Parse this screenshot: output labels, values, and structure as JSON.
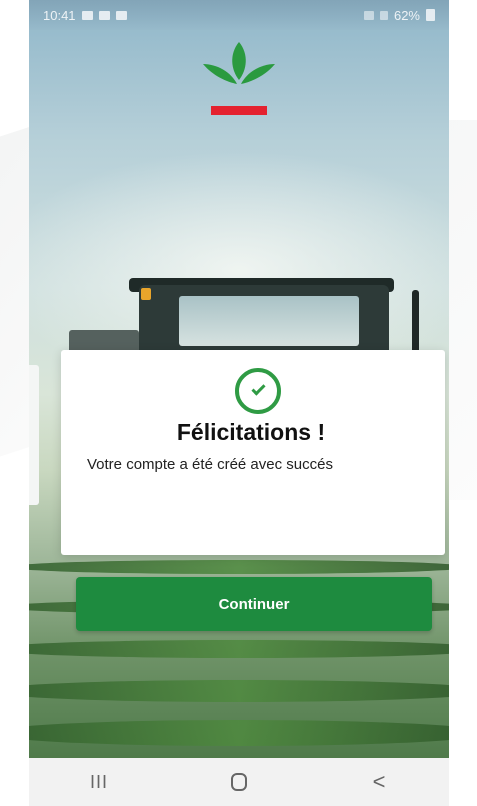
{
  "status_bar": {
    "time": "10:41",
    "battery": "62%"
  },
  "dialog": {
    "icon": "check-circle-icon",
    "title": "Félicitations !",
    "message": "Votre compte a été créé avec succés"
  },
  "actions": {
    "continue_label": "Continuer"
  },
  "nav_bar": {
    "recents_glyph": "III",
    "back_glyph": "<"
  },
  "colors": {
    "primary_green": "#1e8b3f",
    "success_green": "#2f9b44",
    "logo_red": "#e4222f"
  }
}
